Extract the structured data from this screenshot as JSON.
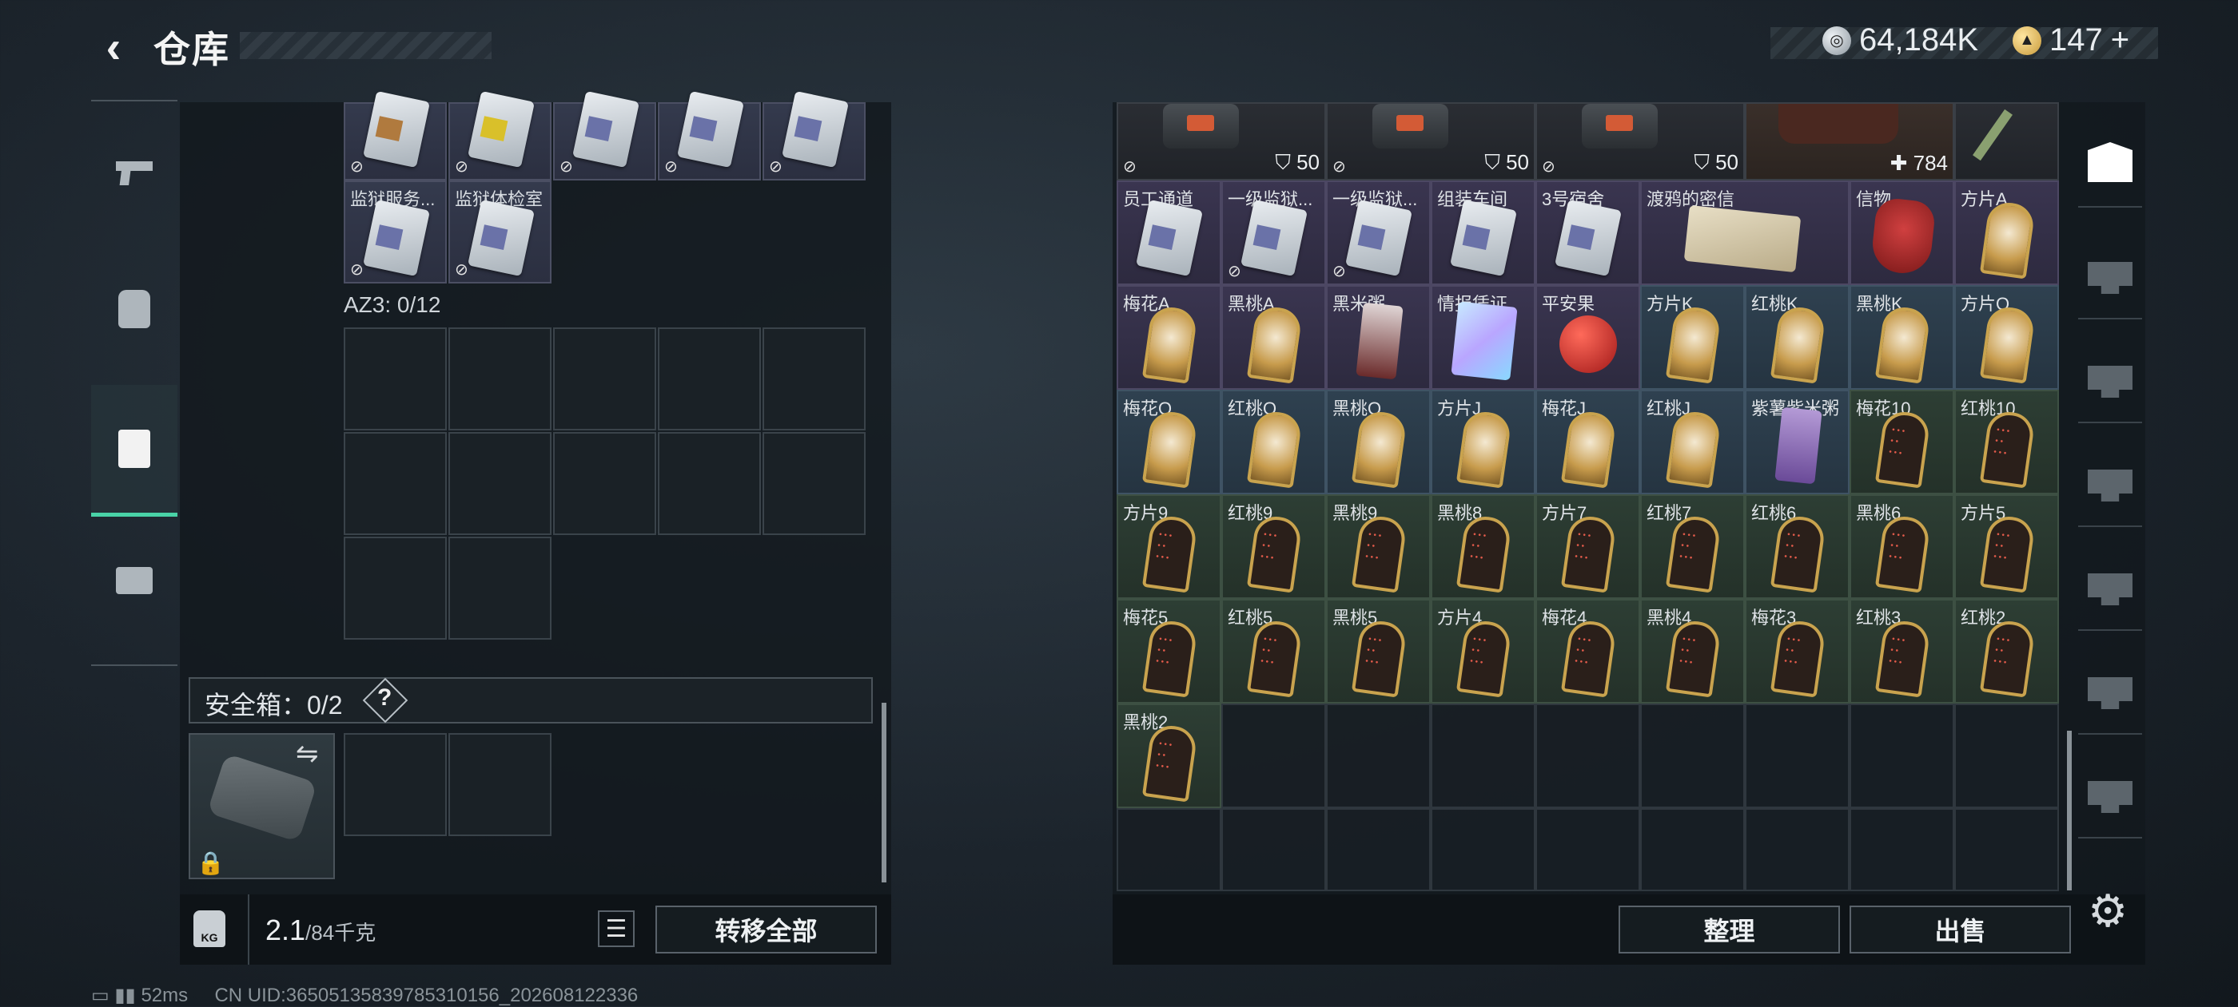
{
  "header": {
    "title": "仓库",
    "silver": "64,184K",
    "gold": "147",
    "gold_plus": "+"
  },
  "left_nav": [
    "gun-icon",
    "backpack-icon",
    "vest-icon",
    "briefcase-icon"
  ],
  "left_panel": {
    "top_row_count": 5,
    "second_row": [
      {
        "label": "监狱服务..."
      },
      {
        "label": "监狱体检室"
      }
    ],
    "az3_label": "AZ3: 0/12",
    "safebox_label": "安全箱：0/2",
    "safebox_help": "?",
    "weight_value": "2.1",
    "weight_cap": "/84千克",
    "weight_icon_text": "KG",
    "transfer_all": "转移全部"
  },
  "right_panel": {
    "top_row": [
      {
        "count": "50"
      },
      {
        "count": "50"
      },
      {
        "count": "50"
      },
      {
        "count": "784"
      }
    ],
    "rows": [
      [
        {
          "label": "员工通道",
          "kind": "keycard",
          "bg": "purple"
        },
        {
          "label": "一级监狱...",
          "kind": "keycard",
          "bg": "purple"
        },
        {
          "label": "一级监狱...",
          "kind": "keycard",
          "bg": "purple"
        },
        {
          "label": "组装车间",
          "kind": "keycard",
          "bg": "purple"
        },
        {
          "label": "3号宿舍",
          "kind": "keycard",
          "bg": "purple"
        },
        {
          "label": "渡鸦的密信",
          "kind": "letter",
          "bg": "purple",
          "span": 2
        },
        {
          "label": "信物",
          "kind": "mask",
          "bg": "purple"
        },
        {
          "label": "方片A",
          "kind": "face",
          "bg": "purple"
        }
      ],
      [
        {
          "label": "梅花A",
          "kind": "face",
          "bg": "purple"
        },
        {
          "label": "黑桃A",
          "kind": "face",
          "bg": "purple"
        },
        {
          "label": "黑米粥",
          "kind": "can",
          "bg": "purple"
        },
        {
          "label": "情报凭证",
          "kind": "ticket",
          "bg": "purple"
        },
        {
          "label": "平安果",
          "kind": "apple",
          "bg": "purple"
        },
        {
          "label": "方片K",
          "kind": "face",
          "bg": "blue"
        },
        {
          "label": "红桃K",
          "kind": "face",
          "bg": "blue"
        },
        {
          "label": "黑桃K",
          "kind": "face",
          "bg": "blue"
        },
        {
          "label": "方片Q",
          "kind": "face",
          "bg": "blue"
        }
      ],
      [
        {
          "label": "梅花Q",
          "kind": "face",
          "bg": "blue"
        },
        {
          "label": "红桃Q",
          "kind": "face",
          "bg": "blue"
        },
        {
          "label": "黑桃Q",
          "kind": "face",
          "bg": "blue"
        },
        {
          "label": "方片J",
          "kind": "face",
          "bg": "blue"
        },
        {
          "label": "梅花J",
          "kind": "face",
          "bg": "blue"
        },
        {
          "label": "红桃J",
          "kind": "face",
          "bg": "blue"
        },
        {
          "label": "紫薯紫米粥",
          "kind": "can",
          "bg": "blue"
        },
        {
          "label": "梅花10",
          "kind": "num",
          "bg": "green"
        },
        {
          "label": "红桃10",
          "kind": "num",
          "bg": "green"
        }
      ],
      [
        {
          "label": "方片9",
          "kind": "num",
          "bg": "green"
        },
        {
          "label": "红桃9",
          "kind": "num",
          "bg": "green"
        },
        {
          "label": "黑桃9",
          "kind": "num",
          "bg": "green"
        },
        {
          "label": "黑桃8",
          "kind": "num",
          "bg": "green"
        },
        {
          "label": "方片7",
          "kind": "num",
          "bg": "green"
        },
        {
          "label": "红桃7",
          "kind": "num",
          "bg": "green"
        },
        {
          "label": "红桃6",
          "kind": "num",
          "bg": "green"
        },
        {
          "label": "黑桃6",
          "kind": "num",
          "bg": "green"
        },
        {
          "label": "方片5",
          "kind": "num",
          "bg": "green"
        }
      ],
      [
        {
          "label": "梅花5",
          "kind": "num",
          "bg": "green"
        },
        {
          "label": "红桃5",
          "kind": "num",
          "bg": "green"
        },
        {
          "label": "黑桃5",
          "kind": "num",
          "bg": "green"
        },
        {
          "label": "方片4",
          "kind": "num",
          "bg": "green"
        },
        {
          "label": "梅花4",
          "kind": "num",
          "bg": "green"
        },
        {
          "label": "黑桃4",
          "kind": "num",
          "bg": "green"
        },
        {
          "label": "梅花3",
          "kind": "num",
          "bg": "green"
        },
        {
          "label": "红桃3",
          "kind": "num",
          "bg": "green"
        },
        {
          "label": "红桃2",
          "kind": "num",
          "bg": "green"
        }
      ],
      [
        {
          "label": "黑桃2",
          "kind": "num",
          "bg": "green"
        }
      ]
    ],
    "organize": "整理",
    "sell": "出售"
  },
  "right_nav": [
    "helmet-icon",
    "armor-v-icon",
    "armor-v2-icon",
    "armor-iv-icon",
    "rig-iv-icon",
    "rig-iii-icon",
    "rig-iv2-icon"
  ],
  "status": {
    "ping": "52ms",
    "uid": "CN UID:3650513583978531​0156_202608122336"
  }
}
